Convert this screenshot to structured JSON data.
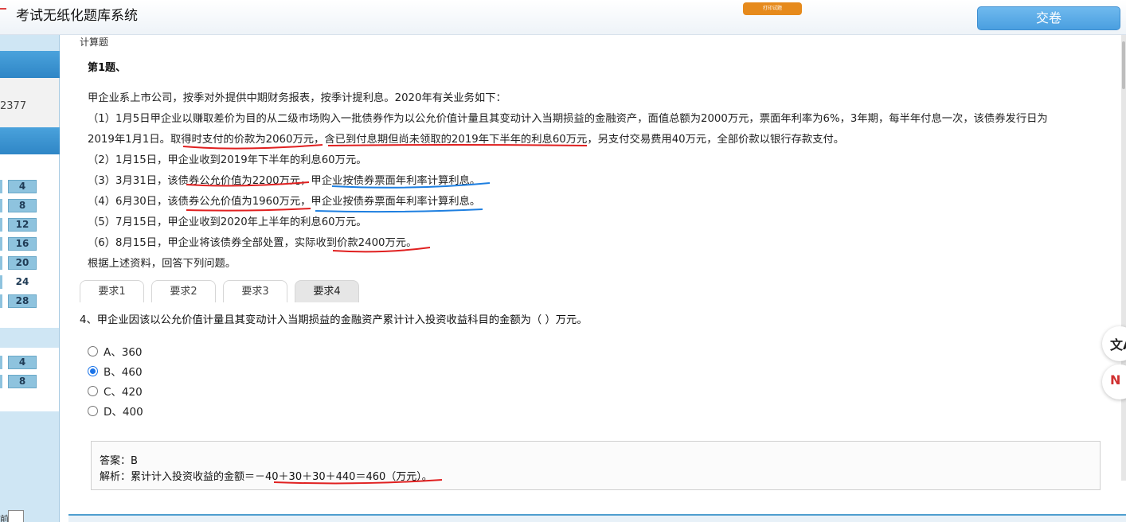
{
  "header": {
    "app_title": "考试无纸化题库系统",
    "print_label": "打印试题",
    "submit_label": "交卷"
  },
  "sidebar": {
    "exam_id_fragment": "2377",
    "group1_numbers": [
      "4",
      "8",
      "12",
      "16",
      "20",
      "24",
      "28"
    ],
    "group2_numbers": [
      "4",
      "8"
    ],
    "current_number": "24",
    "footer_text": "前"
  },
  "main": {
    "section_title": "计算题",
    "question_title": "第1题、",
    "stem_lines": [
      "甲企业系上市公司，按季对外提供中期财务报表，按季计提利息。2020年有关业务如下：",
      "（1）1月5日甲企业以赚取差价为目的从二级市场购入一批债券作为以公允价值计量且其变动计入当期损益的金融资产，面值总额为2000万元，票面年利率为6%，3年期，每半年付息一次，该债券发行日为",
      "2019年1月1日。取得时支付的价款为2060万元，含已到付息期但尚未领取的2019年下半年的利息60万元，另支付交易费用40万元，全部价款以银行存款支付。",
      "（2）1月15日，甲企业收到2019年下半年的利息60万元。",
      "（3）3月31日，该债券公允价值为2200万元，甲企业按债券票面年利率计算利息。",
      "（4）6月30日，该债券公允价值为1960万元，甲企业按债券票面年利率计算利息。",
      "（5）7月15日，甲企业收到2020年上半年的利息60万元。",
      "（6）8月15日，甲企业将该债券全部处置，实际收到价款2400万元。",
      "根据上述资料，回答下列问题。"
    ],
    "tabs": [
      "要求1",
      "要求2",
      "要求3",
      "要求4"
    ],
    "active_tab": "要求4",
    "question": "4、甲企业因该以公允价值计量且其变动计入当期损益的金融资产累计计入投资收益科目的金额为（      ）万元。",
    "options": [
      {
        "label": "A、360",
        "selected": false
      },
      {
        "label": "B、460",
        "selected": true
      },
      {
        "label": "C、420",
        "selected": false
      },
      {
        "label": "D、400",
        "selected": false
      }
    ],
    "answer": "答案：B",
    "analysis": "解析：累计计入投资收益的金额＝－40＋30＋30＋440＝460（万元）。"
  },
  "floating": {
    "translate_glyph": "文A",
    "tool_glyph": "N"
  },
  "colors": {
    "accent_blue": "#4a9fe0",
    "print_orange": "#e68a1c",
    "annotation_red": "#e02020",
    "annotation_blue": "#1e7fe0"
  }
}
